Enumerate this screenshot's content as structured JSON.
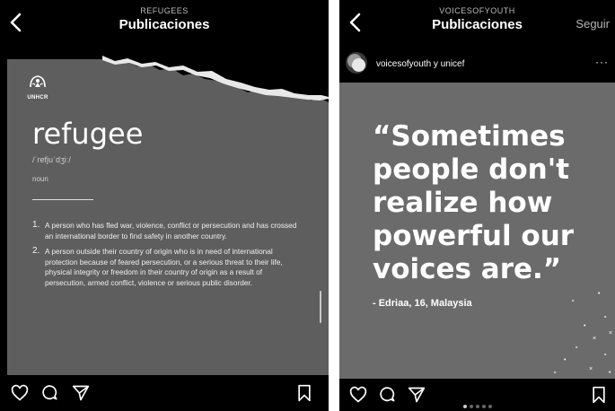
{
  "left": {
    "header": {
      "subtitle": "REFUGEES",
      "title": "Publicaciones"
    },
    "post": {
      "logo_label": "UNHCR",
      "word": "refugee",
      "pronunciation": "/ˈrefjuˈdʒiː/",
      "part_of_speech": "noun",
      "definitions": [
        {
          "num": "1.",
          "text": "A person who has fled war, violence, conflict or persecution and has crossed an international border to find safety in another country."
        },
        {
          "num": "2.",
          "text": "A person outside their country of origin who is in need of international protection because of feared persecution, or a serious threat to their life, physical integrity or freedom in their country of origin as a result of persecution, armed conflict, violence or serious public disorder."
        }
      ]
    },
    "actions": {
      "icons": [
        "heart-icon",
        "comment-icon",
        "share-icon",
        "bookmark-icon"
      ]
    }
  },
  "right": {
    "header": {
      "subtitle": "VOICESOFYOUTH",
      "title": "Publicaciones",
      "follow": "Seguir"
    },
    "user": {
      "name": "voicesofyouth y unicef",
      "more": "···"
    },
    "post": {
      "quote_lines": [
        "“Sometimes",
        "people don't",
        "realize how",
        "powerful our",
        "voices are.”"
      ],
      "attribution": "- Edriaa, 16, Malaysia"
    },
    "carousel": {
      "count": 5,
      "active": 1
    },
    "actions": {
      "icons": [
        "heart-icon",
        "comment-icon",
        "share-icon",
        "bookmark-icon"
      ]
    }
  }
}
